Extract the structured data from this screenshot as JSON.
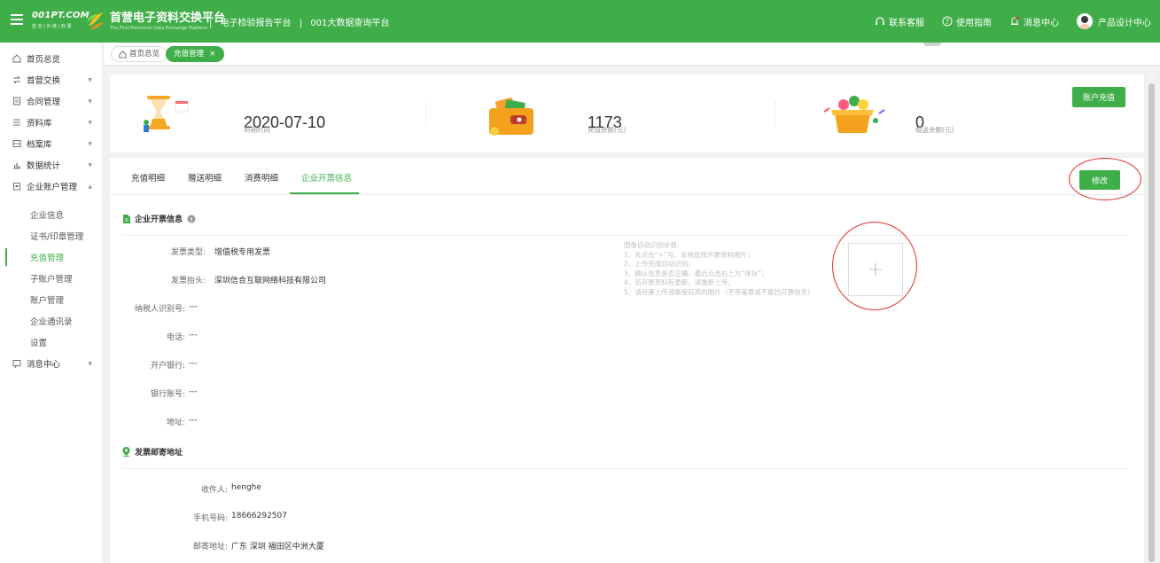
{
  "header": {
    "logo_text": "001PT.COM",
    "logo_sub": "首 音 | 外 链 | 商 服",
    "platform_name": "首营电子资料交换平台",
    "platform_en": "The First Electronic Data Exchange Platform",
    "links": [
      "|",
      "电子检验报告平台",
      "|",
      "001大数据查询平台"
    ],
    "right": {
      "service": "联系客服",
      "guide": "使用指南",
      "messages": "消息中心",
      "user": "产品设计中心"
    }
  },
  "sidebar": {
    "items": [
      {
        "label": "首页总览"
      },
      {
        "label": "首营交换"
      },
      {
        "label": "合同管理"
      },
      {
        "label": "资料库"
      },
      {
        "label": "档案库"
      },
      {
        "label": "数据统计"
      },
      {
        "label": "企业账户管理"
      }
    ],
    "sub_items": [
      {
        "label": "企业信息"
      },
      {
        "label": "证书/印章管理"
      },
      {
        "label": "充值管理"
      },
      {
        "label": "子账户管理"
      },
      {
        "label": "账户管理"
      },
      {
        "label": "企业通讯录"
      },
      {
        "label": "设置"
      }
    ],
    "last_item": {
      "label": "消息中心"
    }
  },
  "tabsbar": {
    "home": "首页总览",
    "current": "充值管理",
    "close": "×"
  },
  "summary": {
    "expire_date": "2020-07-10",
    "expire_label": "到期时间",
    "recharge_balance": "1173",
    "recharge_label": "充值余额(元)",
    "gift_balance": "0",
    "gift_label": "赠送余额(元)",
    "recharge_button": "账户充值"
  },
  "panel": {
    "tabs": [
      "充值明细",
      "赠送明细",
      "消费明细",
      "企业开票信息"
    ],
    "active_tab": 3,
    "edit_button": "修改",
    "invoice_section_title": "企业开票信息",
    "invoice_fields": [
      {
        "key": "发票类型:",
        "value": "增值税专用发票"
      },
      {
        "key": "发票抬头:",
        "value": "深圳信合互联网络科技有限公司"
      },
      {
        "key": "纳税人识别号:",
        "value": "---"
      },
      {
        "key": "电话:",
        "value": "---"
      },
      {
        "key": "开户银行:",
        "value": "---"
      },
      {
        "key": "银行账号:",
        "value": "---"
      },
      {
        "key": "地址:",
        "value": "---"
      }
    ],
    "tips": [
      "图像自动识别步骤:",
      "1、先点击“+”号，本地选择开票资料图片；",
      "2、上传完成自动识别；",
      "3、确认信息是否正确，最后点击右上方“保存”；",
      "4、若开票资料有更新，请重新上传；",
      "5、请尽量上传清晰度较高的图片（不带盖章或不能挡开票信息）"
    ],
    "upload_plus": "+",
    "mail_section_title": "发票邮寄地址",
    "mail_fields": [
      {
        "key": "收件人:",
        "value": "henghe"
      },
      {
        "key": "手机号码:",
        "value": "18666292507"
      },
      {
        "key": "邮寄地址:",
        "value": "广东 深圳 福田区中洲大厦"
      }
    ]
  },
  "colors": {
    "brand": "#3fae49",
    "highlight": "#e0302b"
  }
}
